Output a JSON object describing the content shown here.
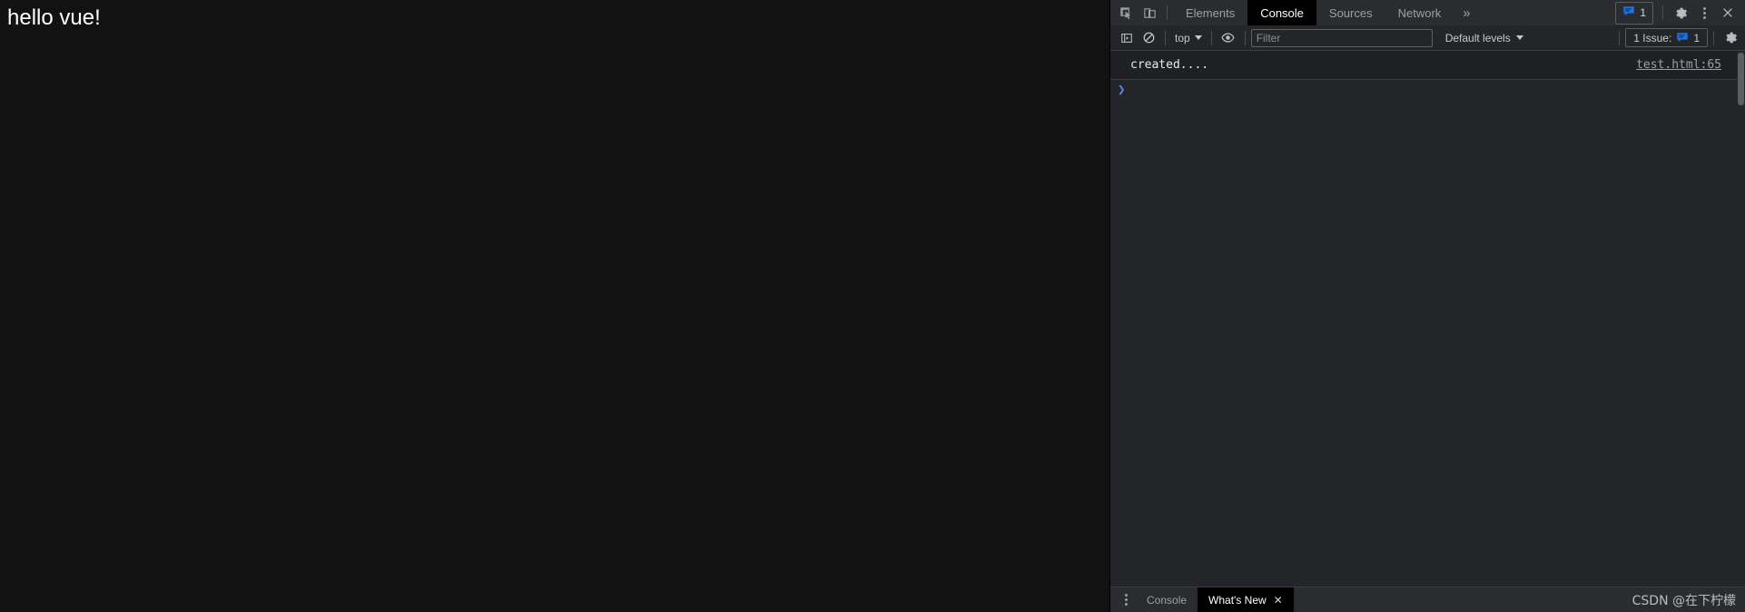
{
  "page": {
    "heading": "hello vue!",
    "background_color": "#121212",
    "text_color": "#ffffff"
  },
  "devtools": {
    "background_color": "#242529",
    "accent_color": "#4f8fe8",
    "toolbar": {
      "inspect_icon": "inspect-element-icon",
      "device_icon": "device-toolbar-icon",
      "tabs": [
        {
          "label": "Elements",
          "active": false
        },
        {
          "label": "Console",
          "active": true
        },
        {
          "label": "Sources",
          "active": false
        },
        {
          "label": "Network",
          "active": false
        }
      ],
      "overflow_label": "»",
      "messages_badge": {
        "icon": "message-icon",
        "count": "1"
      },
      "settings_icon": "gear-icon",
      "more_icon": "kebab-menu-icon",
      "close_icon": "close-icon"
    },
    "filterbar": {
      "sidebar_toggle_icon": "console-sidebar-icon",
      "clear_icon": "clear-console-icon",
      "context": {
        "label": "top",
        "caret": "▼"
      },
      "eye_icon": "live-expression-icon",
      "filter": {
        "value": "",
        "placeholder": "Filter"
      },
      "levels": {
        "label": "Default levels",
        "caret": "▼"
      },
      "issues": {
        "label": "1 Issue:",
        "icon": "message-icon",
        "count": "1"
      },
      "settings_icon": "gear-icon"
    },
    "console": {
      "messages": [
        {
          "text": "created....",
          "source": "test.html:65"
        }
      ],
      "prompt_symbol": "❯"
    },
    "drawer": {
      "menu_icon": "kebab-menu-icon",
      "tabs": [
        {
          "label": "Console",
          "active": false,
          "closable": false
        },
        {
          "label": "What's New",
          "active": true,
          "closable": true,
          "close_label": "✕"
        }
      ]
    }
  },
  "watermark": {
    "text": "CSDN @在下柠檬"
  }
}
